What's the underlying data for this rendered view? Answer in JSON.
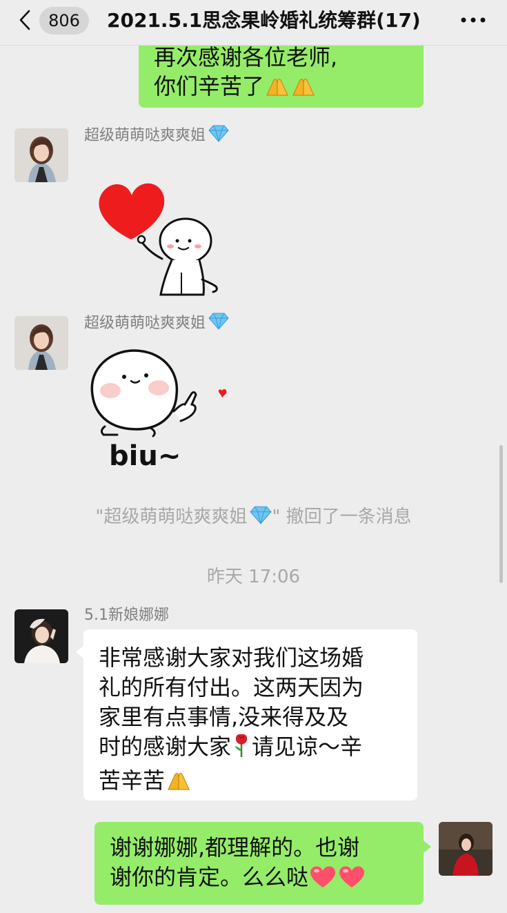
{
  "header": {
    "unread_count": "806",
    "title": "2021.5.1思念果岭婚礼统筹群(17)"
  },
  "messages": {
    "top_outgoing": {
      "line1": "再次感谢各位老师,",
      "line2": "你们辛苦了"
    },
    "sticker_1": {
      "sender": "超级萌萌哒爽爽姐"
    },
    "sticker_2": {
      "sender": "超级萌萌哒爽爽姐",
      "caption": "biu~"
    },
    "recall_notice": {
      "prefix": "\"超级萌萌哒爽爽姐",
      "suffix": "\" 撤回了一条消息"
    },
    "timestamp": "昨天 17:06",
    "bride_message": {
      "sender": "5.1新娘娜娜",
      "line1": "非常感谢大家对我们这场婚",
      "line2": "礼的所有付出。这两天因为",
      "line3": "家里有点事情,没来得及及",
      "line4a": "时的感谢大家",
      "line4b": "请见谅～辛",
      "line5": "苦辛苦"
    },
    "reply": {
      "line1": "谢谢娜娜,都理解的。也谢",
      "line2": "谢你的肯定。么么哒"
    }
  },
  "icons": {
    "back": "chevron-left-icon",
    "more": "more-dots-icon",
    "gem": "diamond-icon",
    "pray": "praying-hands-icon",
    "rose": "rose-icon",
    "heart": "heart-icon"
  },
  "colors": {
    "outgoing_bubble": "#95ec69",
    "incoming_bubble": "#ffffff",
    "background": "#ededed"
  }
}
